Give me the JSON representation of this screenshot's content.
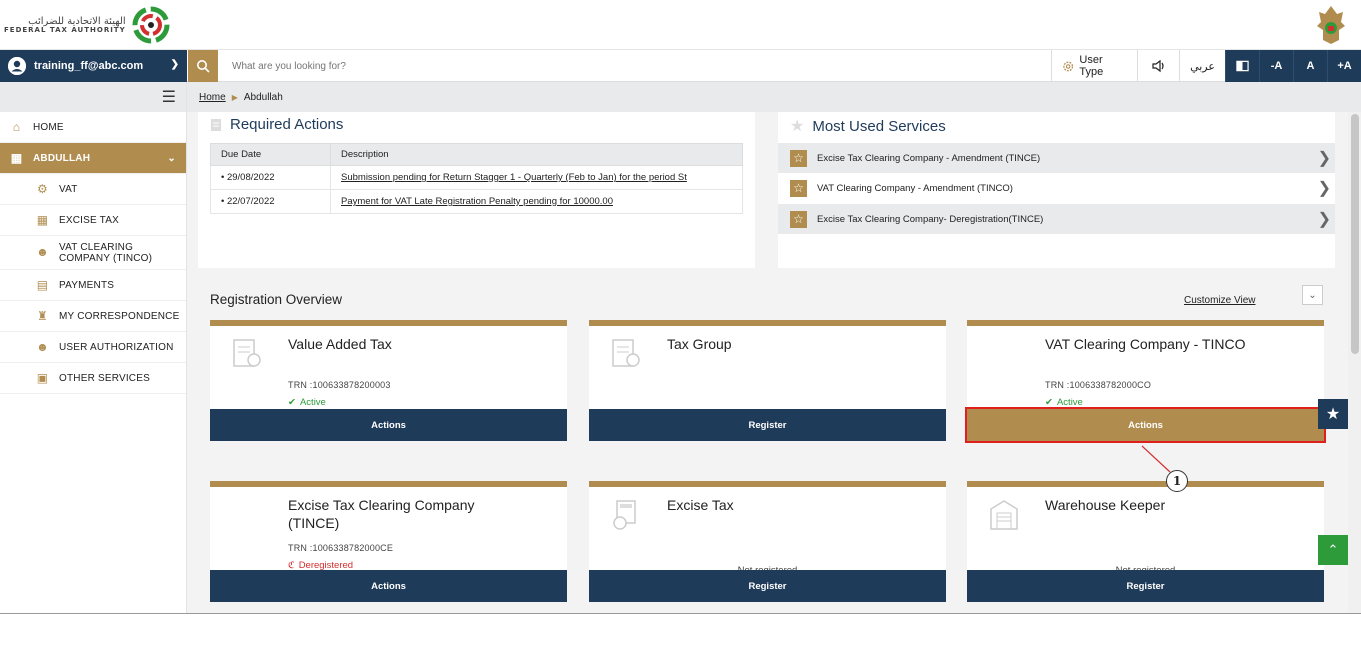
{
  "header": {
    "logo_arabic": "الهيئة الاتحادية للضرائب",
    "logo_english": "FEDERAL TAX AUTHORITY"
  },
  "navbar": {
    "user_email": "training_ff@abc.com",
    "search_placeholder": "What are you looking for?",
    "user_type_label": "User Type",
    "language_label": "عربي",
    "font_decrease": "-A",
    "font_normal": "A",
    "font_increase": "+A"
  },
  "sidebar": {
    "items": [
      {
        "label": "HOME",
        "icon": "home-icon"
      },
      {
        "label": "ABDULLAH",
        "icon": "grid-icon"
      },
      {
        "label": "VAT",
        "icon": "vat-icon"
      },
      {
        "label": "EXCISE TAX",
        "icon": "excise-icon"
      },
      {
        "label": "VAT CLEARING COMPANY (TINCO)",
        "icon": "user-icon"
      },
      {
        "label": "PAYMENTS",
        "icon": "payment-icon"
      },
      {
        "label": "MY CORRESPONDENCE",
        "icon": "bank-icon"
      },
      {
        "label": "USER AUTHORIZATION",
        "icon": "user-icon"
      },
      {
        "label": "OTHER SERVICES",
        "icon": "clipboard-icon"
      }
    ]
  },
  "breadcrumb": {
    "home": "Home",
    "current": "Abdullah"
  },
  "required_actions": {
    "title": "Required Actions",
    "columns": [
      "Due Date",
      "Description"
    ],
    "rows": [
      {
        "date": "• 29/08/2022",
        "description": "Submission pending for Return Stagger 1 - Quarterly (Feb to Jan) for the period St"
      },
      {
        "date": "• 22/07/2022",
        "description": "Payment for VAT Late Registration Penalty pending for 10000.00"
      }
    ]
  },
  "most_used": {
    "title": "Most Used Services",
    "items": [
      "Excise Tax Clearing Company - Amendment (TINCE)",
      "VAT Clearing Company - Amendment (TINCO)",
      "Excise Tax Clearing Company- Deregistration(TINCE)"
    ]
  },
  "registration": {
    "title": "Registration Overview",
    "customize_label": "Customize View",
    "cards": [
      {
        "title": "Value Added Tax",
        "trn": "TRN :100633878200003",
        "status": "Active",
        "button": "Actions"
      },
      {
        "title": "Tax Group",
        "trn": "",
        "status": "",
        "button": "Register"
      },
      {
        "title": "VAT Clearing Company - TINCO",
        "trn": "TRN :1006338782000CO",
        "status": "Active",
        "button": "Actions"
      },
      {
        "title": "Excise Tax Clearing Company (TINCE)",
        "trn": "TRN :1006338782000CE",
        "status": "Deregistered",
        "button": "Actions"
      },
      {
        "title": "Excise Tax",
        "trn": "",
        "status": "Not registered",
        "button": "Register"
      },
      {
        "title": "Warehouse Keeper",
        "trn": "",
        "status": "Not registered",
        "button": "Register"
      }
    ]
  },
  "callout": {
    "number": "1"
  },
  "colors": {
    "navy": "#1f3b5a",
    "gold": "#b08d4f",
    "green": "#2e9b3a",
    "red": "#d32f2f"
  }
}
